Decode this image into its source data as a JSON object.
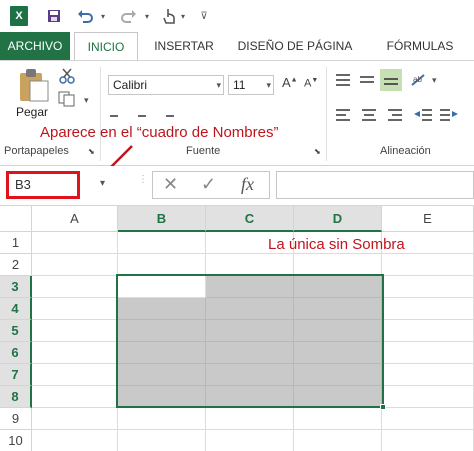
{
  "quick_access": {
    "logo_icon": "excel-logo-icon",
    "save_icon": "save-icon",
    "undo_icon": "undo-icon",
    "redo_icon": "redo-icon",
    "touch_icon": "touch-mode-icon",
    "customize_icon": "customize-qat-icon"
  },
  "tabs": [
    "ARCHIVO",
    "INICIO",
    "INSERTAR",
    "DISEÑO DE PÁGINA",
    "FÓRMULAS"
  ],
  "active_tab": "INICIO",
  "ribbon": {
    "paste_label": "Pegar",
    "font_name": "Calibri",
    "font_size": "11",
    "groups": [
      "Portapapeles",
      "Fuente",
      "Alineación"
    ]
  },
  "annotations": {
    "namebox_note": "Aparece en el “cuadro de Nombres”",
    "cell_note": "La única sin Sombra",
    "color": "#c0141c"
  },
  "formula_bar": {
    "name_box_value": "B3",
    "formula_value": "",
    "fx_label": "fx"
  },
  "grid": {
    "columns": [
      "A",
      "B",
      "C",
      "D",
      "E"
    ],
    "rows": [
      "1",
      "2",
      "3",
      "4",
      "5",
      "6",
      "7",
      "8",
      "9",
      "10"
    ],
    "active_cell": "B3",
    "selection": "B3:D8",
    "selection_color": "#217346",
    "shade_color": "#c9c9c9"
  }
}
